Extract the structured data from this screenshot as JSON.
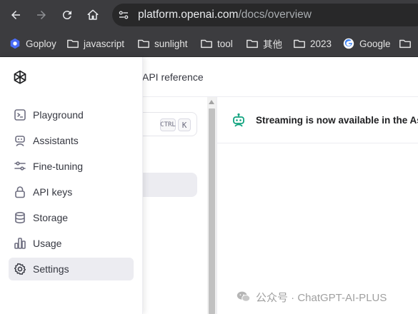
{
  "browser": {
    "url_host": "platform.openai.com",
    "url_path": "/docs/overview",
    "bookmarks": [
      {
        "label": "Goploy",
        "icon": "goploy-icon"
      },
      {
        "label": "javascript",
        "icon": "folder-icon"
      },
      {
        "label": "sunlight",
        "icon": "folder-icon"
      },
      {
        "label": "tool",
        "icon": "folder-icon"
      },
      {
        "label": "其他",
        "icon": "folder-icon"
      },
      {
        "label": "2023",
        "icon": "folder-icon"
      },
      {
        "label": "Google",
        "icon": "google-icon"
      },
      {
        "label": "",
        "icon": "folder-icon"
      }
    ]
  },
  "topnav": {
    "api_reference": "API reference"
  },
  "docs": {
    "search_kbd_ctrl": "CTRL",
    "search_kbd_k": "K"
  },
  "banner": {
    "text": "Streaming is now available in the Assistants API"
  },
  "sidebar": {
    "items": [
      {
        "label": "Playground",
        "icon": "terminal-icon"
      },
      {
        "label": "Assistants",
        "icon": "robot-icon"
      },
      {
        "label": "Fine-tuning",
        "icon": "sliders-icon"
      },
      {
        "label": "API keys",
        "icon": "lock-icon"
      },
      {
        "label": "Storage",
        "icon": "database-icon"
      },
      {
        "label": "Usage",
        "icon": "bar-chart-icon"
      },
      {
        "label": "Settings",
        "icon": "gear-icon",
        "active": true
      }
    ]
  },
  "watermark": {
    "text": "公众号 · ChatGPT-AI-PLUS"
  },
  "colors": {
    "chrome": "#3c3c3f",
    "omnibox": "#282829",
    "accent_green": "#10a37f",
    "active_bg": "#ececf1"
  }
}
